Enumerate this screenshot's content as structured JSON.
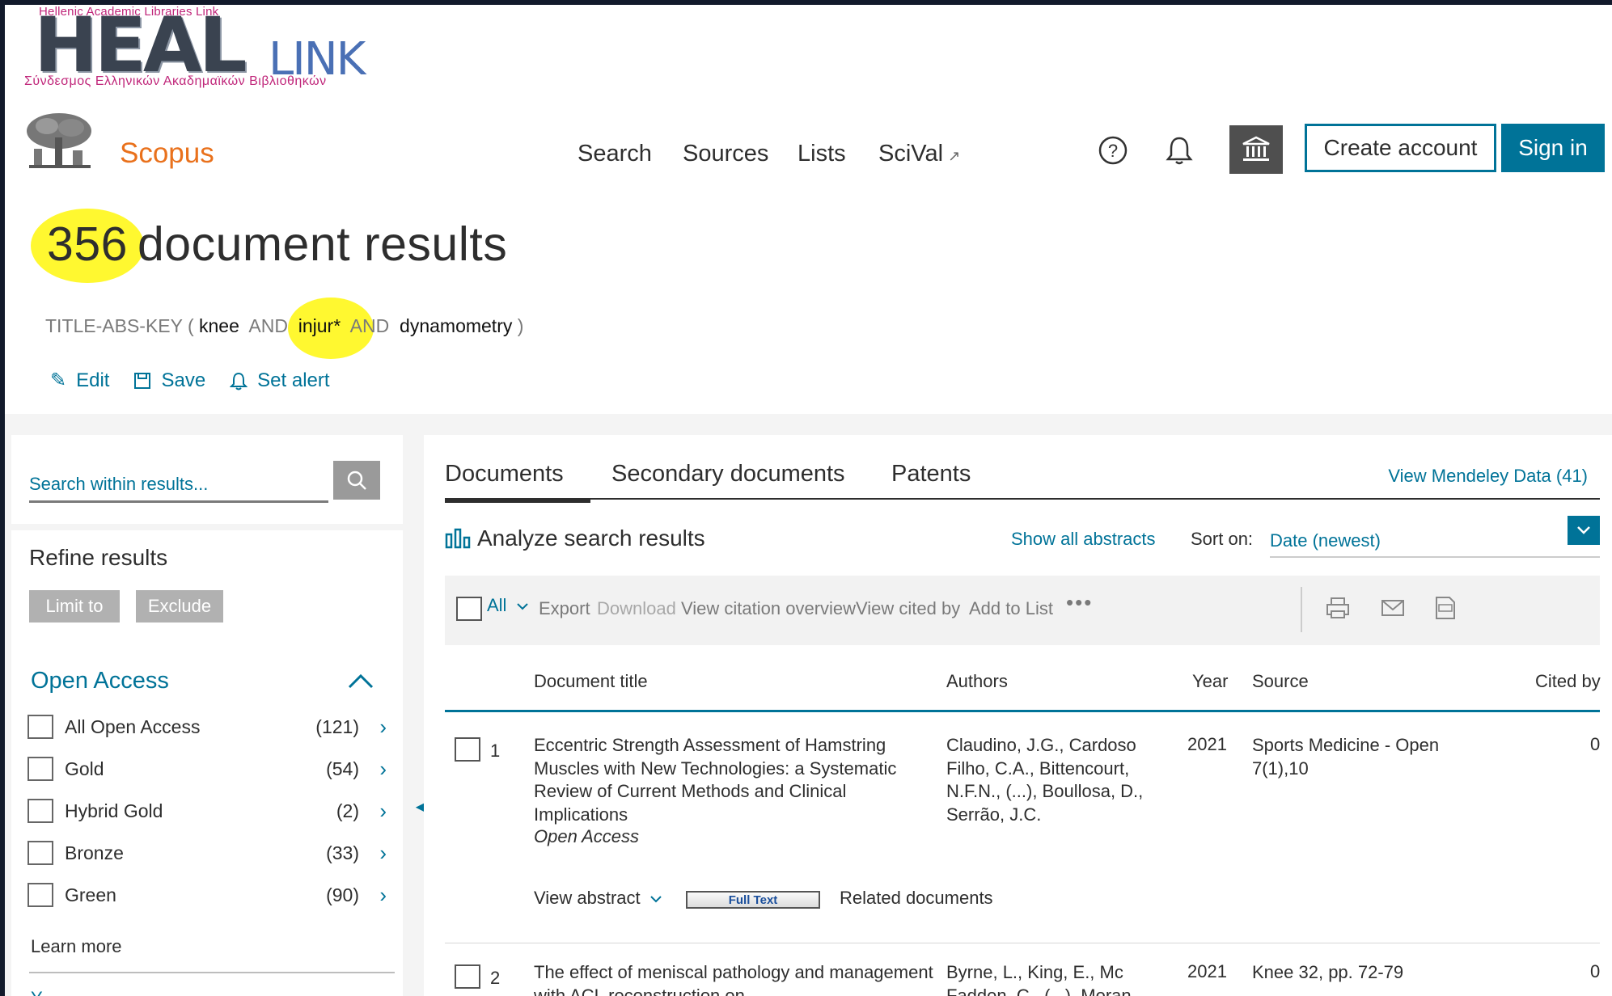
{
  "heal_logo": {
    "top_text": "Hellenic Academic Libraries Link",
    "heal": "HEAL",
    "link": "LINK",
    "bottom_text": "Σύνδεσμος Ελληνικών Ακαδημαϊκών Βιβλιοθηκών"
  },
  "header": {
    "brand": "Scopus",
    "nav": [
      "Search",
      "Sources",
      "Lists",
      "SciVal"
    ],
    "nav_ext_icon": "external-arrow",
    "create_account": "Create account",
    "sign_in": "Sign in",
    "icons": [
      "help-circle-icon",
      "bell-icon",
      "institution-icon"
    ]
  },
  "results": {
    "count": "356",
    "label": "document results",
    "query": {
      "prefix": "TITLE-ABS-KEY ( ",
      "term1": "knee",
      "op1": "  AND  ",
      "term2": "injur*",
      "op2": "  AND  ",
      "term3": "dynamometry",
      "suffix": " )"
    },
    "actions": [
      "Edit",
      "Save",
      "Set alert"
    ]
  },
  "left": {
    "search_placeholder": "Search within results...",
    "refine_title": "Refine results",
    "limit_to": "Limit to",
    "exclude": "Exclude",
    "open_access_title": "Open Access",
    "open_access_items": [
      {
        "label": "All Open Access",
        "count": "(121)"
      },
      {
        "label": "Gold",
        "count": "(54)"
      },
      {
        "label": "Hybrid Gold",
        "count": "(2)"
      },
      {
        "label": "Bronze",
        "count": "(33)"
      },
      {
        "label": "Green",
        "count": "(90)"
      }
    ],
    "learn_more": "Learn more",
    "next_facet_partial": "Y"
  },
  "main": {
    "tabs": [
      "Documents",
      "Secondary documents",
      "Patents"
    ],
    "mendeley": "View Mendeley Data (41)",
    "analyze": "Analyze search results",
    "show_abstracts": "Show all abstracts",
    "sort_label": "Sort on:",
    "sort_value": "Date (newest)",
    "toolbar": {
      "all": "All",
      "export": "Export",
      "download": "Download",
      "view_citation": "View citation overview",
      "view_cited_by": "View cited by",
      "add_to_list": "Add to List",
      "more": "•••"
    },
    "columns": {
      "title": "Document title",
      "authors": "Authors",
      "year": "Year",
      "source": "Source",
      "cited": "Cited by"
    },
    "rows": [
      {
        "num": "1",
        "title": "Eccentric Strength Assessment of Hamstring Muscles with New Technologies: a Systematic Review of Current Methods and Clinical Implications",
        "oa": "Open Access",
        "authors": "Claudino, J.G., Cardoso Filho, C.A., Bittencourt, N.F.N., (...), Boullosa, D., Serrão, J.C.",
        "year": "2021",
        "source": "Sports Medicine - Open 7(1),10",
        "cited": "0",
        "view_abstract": "View abstract",
        "full_text": "Full Text",
        "related": "Related documents"
      },
      {
        "num": "2",
        "title": "The effect of meniscal pathology and management with ACL reconstruction on",
        "authors": "Byrne, L., King, E., Mc Fadden, C., (...), Moran,",
        "year": "2021",
        "source": "Knee 32, pp. 72-79",
        "cited": "0"
      }
    ]
  },
  "colors": {
    "accent": "#007398",
    "brand_orange": "#e9711c",
    "highlight": "#fff830"
  }
}
